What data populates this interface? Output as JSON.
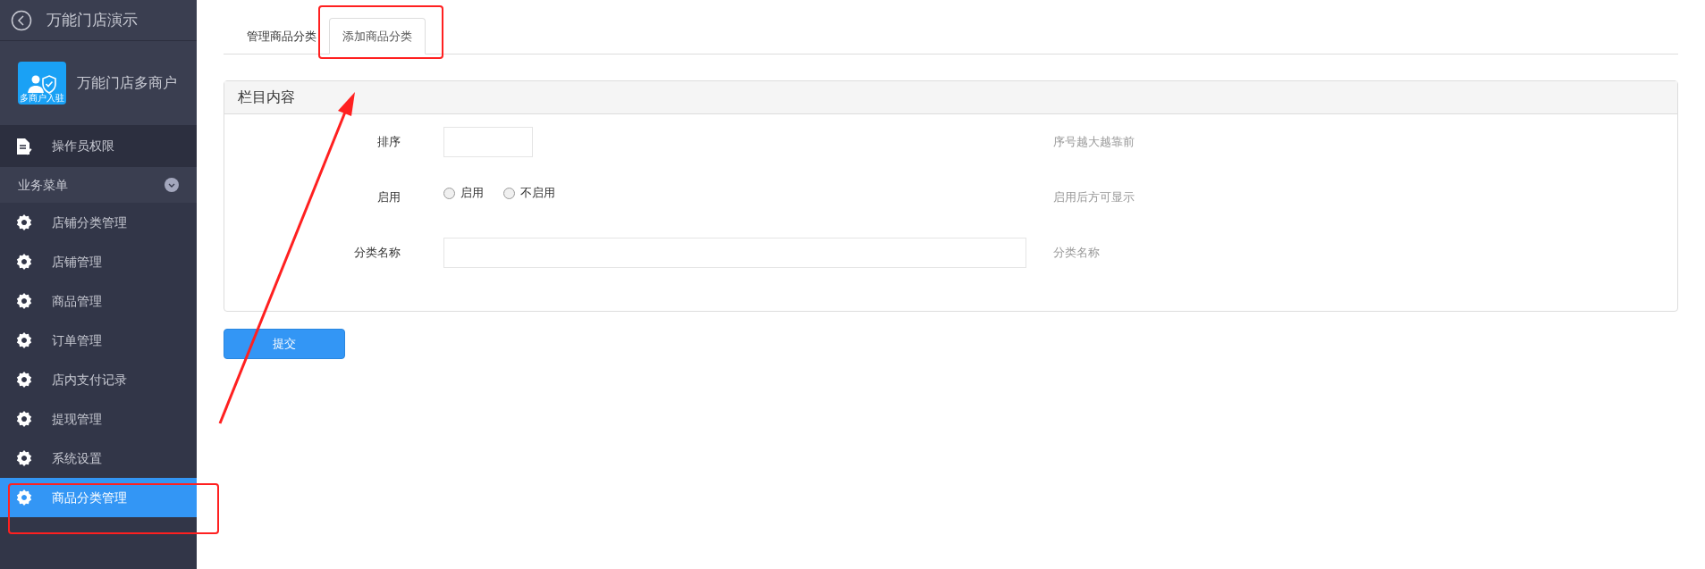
{
  "sidebar": {
    "title": "万能门店演示",
    "brand": {
      "name": "万能门店多商户",
      "logo_text": "多商户入驻"
    },
    "top_item": {
      "label": "操作员权限"
    },
    "section": {
      "label": "业务菜单",
      "expanded": true
    },
    "items": [
      {
        "label": "店铺分类管理",
        "selected": false
      },
      {
        "label": "店铺管理",
        "selected": false
      },
      {
        "label": "商品管理",
        "selected": false
      },
      {
        "label": "订单管理",
        "selected": false
      },
      {
        "label": "店内支付记录",
        "selected": false
      },
      {
        "label": "提现管理",
        "selected": false
      },
      {
        "label": "系统设置",
        "selected": false
      },
      {
        "label": "商品分类管理",
        "selected": true
      }
    ]
  },
  "tabs": [
    {
      "label": "管理商品分类",
      "selected": false
    },
    {
      "label": "添加商品分类",
      "selected": true
    }
  ],
  "panel": {
    "title": "栏目内容",
    "rows": [
      {
        "kind": "short_input",
        "label": "排序",
        "hint": "序号越大越靠前"
      },
      {
        "kind": "radio",
        "label": "启用",
        "options": [
          {
            "label": "启用",
            "selected": false
          },
          {
            "label": "不启用",
            "selected": false
          }
        ],
        "hint": "启用后方可显示"
      },
      {
        "kind": "long_input",
        "label": "分类名称",
        "hint": "分类名称"
      }
    ]
  },
  "submit": "提交"
}
